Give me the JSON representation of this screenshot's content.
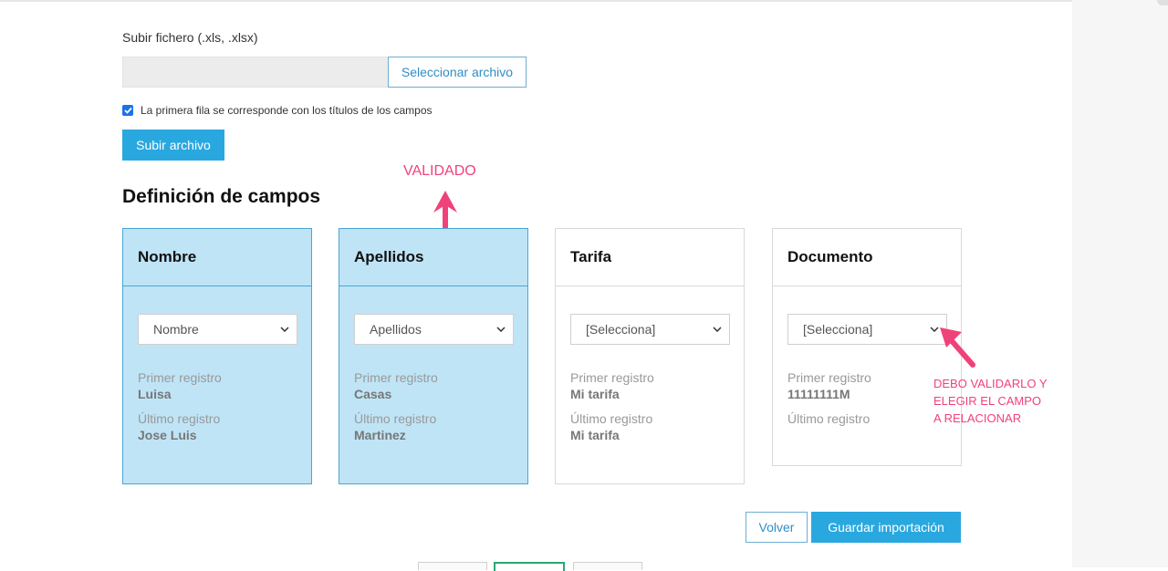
{
  "upload": {
    "label": "Subir fichero (.xls, .xlsx)",
    "file_path_value": "",
    "select_file_button": "Seleccionar archivo",
    "first_row_checkbox_label": "La primera fila se corresponde con los títulos de los campos",
    "first_row_checked": true,
    "upload_button": "Subir archivo"
  },
  "section_title": "Definición de campos",
  "fields": [
    {
      "name": "Nombre",
      "selected": "Nombre",
      "first_label": "Primer registro",
      "first_value": "Luisa",
      "last_label": "Último registro",
      "last_value": "Jose Luis",
      "validated": true
    },
    {
      "name": "Apellidos",
      "selected": "Apellidos",
      "first_label": "Primer registro",
      "first_value": "Casas",
      "last_label": "Último registro",
      "last_value": "Martinez",
      "validated": true
    },
    {
      "name": "Tarifa",
      "selected": "[Selecciona]",
      "first_label": "Primer registro",
      "first_value": "Mi tarifa",
      "last_label": "Último registro",
      "last_value": "Mi tarifa",
      "validated": false
    },
    {
      "name": "Documento",
      "selected": "[Selecciona]",
      "first_label": "Primer registro",
      "first_value": "11111111M",
      "last_label": "Último registro",
      "last_value": "",
      "validated": false
    }
  ],
  "annotations": {
    "validado": "VALIDADO",
    "debo_line1": "DEBO VALIDARLO Y",
    "debo_line2": "ELEGIR EL CAMPO",
    "debo_line3": "A RELACIONAR",
    "color": "#f0427a"
  },
  "actions": {
    "back": "Volver",
    "save": "Guardar importación"
  },
  "colors": {
    "primary": "#29a8e0",
    "validated_bg": "#bfe4f6",
    "validated_border": "#4aa6d6"
  }
}
